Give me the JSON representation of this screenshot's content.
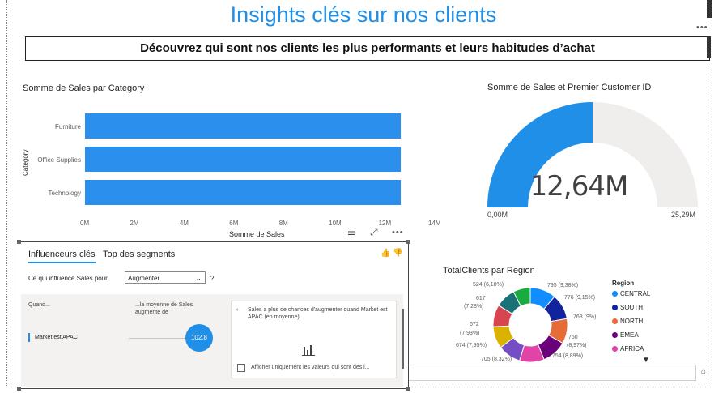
{
  "header": {
    "title": "Insights clés sur nos clients",
    "subtitle": "Découvrez qui sont nos clients les plus performants et leurs habitudes d’achat"
  },
  "bar_chart": {
    "title": "Somme de Sales par Category",
    "ylabel": "Category",
    "xlabel": "Somme de Sales",
    "ticks": [
      "0M",
      "2M",
      "4M",
      "6M",
      "8M",
      "10M",
      "12M",
      "14M"
    ]
  },
  "gauge": {
    "title": "Somme de Sales et Premier Customer ID",
    "value_label": "12,64M",
    "min_label": "0,00M",
    "max_label": "25,29M",
    "fill_fraction": 0.5
  },
  "influencers": {
    "tab_1": "Influenceurs clés",
    "tab_2": "Top des segments",
    "question": "Ce qui influence Sales pour",
    "dropdown_value": "Augmenter",
    "question_mark": "?",
    "col_when": "Quand...",
    "col_avg": "...la moyenne de Sales augmente de",
    "factor": "Market est APAC",
    "bubble_value": "102,8",
    "detail_text": "Sales a plus de chances d'augmenter quand Market est APAC (en moyenne).",
    "checkbox_label": "Afficher uniquement les valeurs qui sont des i..."
  },
  "donut": {
    "title": "TotalClients par Region",
    "legend_title": "Region",
    "labels": [
      "524 (6,18%)",
      "617",
      "(7,28%)",
      "672",
      "(7,93%)",
      "674 (7,95%)",
      "705 (8,32%)",
      "754 (8,89%)",
      "760",
      "(8,97%)",
      "763 (9%)",
      "776 (9,15%)",
      "795 (9,38%)"
    ]
  },
  "chart_data": [
    {
      "type": "bar",
      "title": "Somme de Sales par Category",
      "xlabel": "Somme de Sales",
      "ylabel": "Category",
      "categories": [
        "Furniture",
        "Office Supplies",
        "Technology"
      ],
      "values": [
        12.7,
        12.7,
        12.7
      ],
      "xlim": [
        0,
        14
      ],
      "unit": "M"
    },
    {
      "type": "pie",
      "title": "TotalClients par Region",
      "legend_title": "Region",
      "legend": [
        "CENTRAL",
        "SOUTH",
        "NORTH",
        "EMEA",
        "AFRICA"
      ],
      "values": [
        795,
        776,
        763,
        760,
        754,
        705,
        674,
        672,
        617,
        524
      ],
      "labels": [
        "795 (9,38%)",
        "776 (9,15%)",
        "763 (9%)",
        "760 (8,97%)",
        "754 (8,89%)",
        "705 (8,32%)",
        "674 (7,95%)",
        "672 (7,93%)",
        "617 (7,28%)",
        "524 (6,18%)"
      ],
      "colors": [
        "#118dff",
        "#12239e",
        "#e66c37",
        "#6b007b",
        "#e044a7",
        "#744ec2",
        "#d9b300",
        "#d64550",
        "#197278",
        "#1aab40"
      ]
    }
  ]
}
